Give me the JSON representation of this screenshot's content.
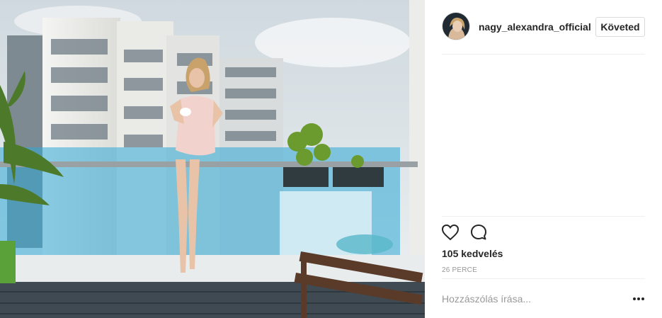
{
  "post": {
    "user": {
      "username": "nagy_alexandra_official",
      "avatar_icon": "avatar-icon"
    },
    "follow_label": "Követed",
    "likes_text": "105 kedvelés",
    "time_text": "26 PERCE",
    "comment_placeholder": "Hozzászólás írása...",
    "icons": {
      "like": "heart-icon",
      "comment": "comment-bubble-icon",
      "more": "more-options-icon"
    },
    "colors": {
      "text": "#262626",
      "secondary_text": "#999999",
      "border": "#dbdbdb"
    }
  }
}
